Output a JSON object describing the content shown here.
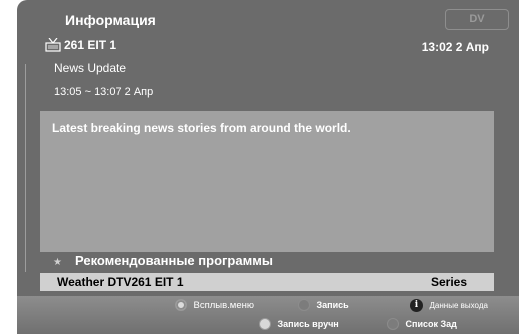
{
  "header": {
    "title": "Информация",
    "logo_text": "DV"
  },
  "channel": {
    "icon": "tv-antenna-icon",
    "label": "261 EIT 1",
    "datetime": "13:02 2 Апр"
  },
  "program": {
    "title": "News Update",
    "time": "13:05 ~ 13:07 2 Апр",
    "description": "Latest breaking news stories from around the world."
  },
  "recommended": {
    "header": "Рекомендованные программы",
    "item_name": "Weather DTV261 EIT 1",
    "item_type": "Series"
  },
  "footer": {
    "popup_menu": "Всплыв.меню",
    "record": "Запись",
    "info": "Данные выхода",
    "manual_record": "Запись вручн",
    "schedule_list": "Список Зад"
  },
  "colors": {
    "panel": "#6b6b6b",
    "description_box": "#a1a1a1",
    "recommended_row": "#d0d0d0"
  }
}
